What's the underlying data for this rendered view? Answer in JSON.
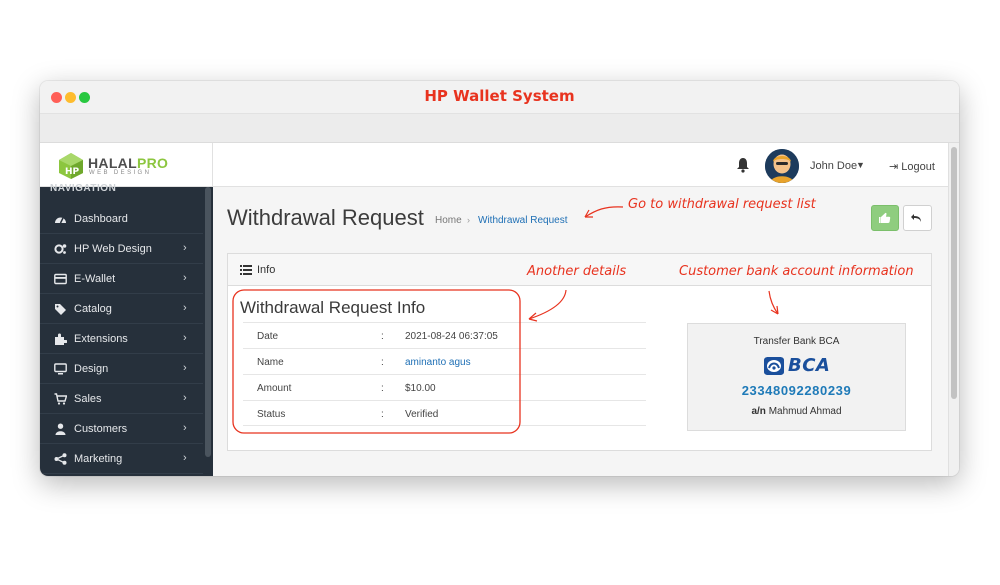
{
  "window": {
    "title": "HP Wallet System"
  },
  "header": {
    "logo": {
      "name_a": "HALAL",
      "name_b": "PRO",
      "sub": "WEB DESIGN"
    },
    "user_name": "John Doe",
    "logout_label": "Logout",
    "icons": [
      "bell-icon",
      "user-avatar",
      "caret-down-icon",
      "logout-icon"
    ]
  },
  "sidebar": {
    "cut_heading": "NAVIGATION",
    "items": [
      {
        "label": "Dashboard",
        "icon": "dashboard-icon",
        "has_children": false
      },
      {
        "label": "HP Web Design",
        "icon": "cogs-icon",
        "has_children": true
      },
      {
        "label": "E-Wallet",
        "icon": "credit-card-icon",
        "has_children": true
      },
      {
        "label": "Catalog",
        "icon": "tag-icon",
        "has_children": true
      },
      {
        "label": "Extensions",
        "icon": "puzzle-icon",
        "has_children": true
      },
      {
        "label": "Design",
        "icon": "monitor-icon",
        "has_children": true
      },
      {
        "label": "Sales",
        "icon": "cart-icon",
        "has_children": true
      },
      {
        "label": "Customers",
        "icon": "user-icon",
        "has_children": true
      },
      {
        "label": "Marketing",
        "icon": "share-icon",
        "has_children": true
      }
    ],
    "chevron": "›"
  },
  "main": {
    "title": "Withdrawal Request",
    "breadcrumb": {
      "home": "Home",
      "separator": "›",
      "current": "Withdrawal Request"
    },
    "buttons": {
      "approve_icon": "thumbs-up-icon",
      "back_icon": "reply-icon"
    },
    "panel": {
      "heading": "Info",
      "section_title": "Withdrawal Request Info",
      "rows": [
        {
          "label": "Date",
          "colon": ":",
          "value": "2021-08-24 06:37:05",
          "is_link": false
        },
        {
          "label": "Name",
          "colon": ":",
          "value": "aminanto agus",
          "is_link": true
        },
        {
          "label": "Amount",
          "colon": ":",
          "value": "$10.00",
          "is_link": false
        },
        {
          "label": "Status",
          "colon": ":",
          "value": "Verified",
          "is_link": false
        }
      ],
      "bank": {
        "title": "Transfer Bank BCA",
        "bank_name": "BCA",
        "account_number": "23348092280239",
        "holder_prefix": "a/n",
        "holder_name": "Mahmud Ahmad"
      }
    }
  },
  "annotations": {
    "goto_list": "Go to withdrawal request list",
    "another_details": "Another details",
    "bank_info": "Customer bank account information"
  },
  "colors": {
    "annotation": "#e8331f",
    "sidebar_bg": "#26303b",
    "link": "#1e6fb5",
    "approve_button": "#8fcd7f",
    "bank_number": "#1e7ab8"
  }
}
